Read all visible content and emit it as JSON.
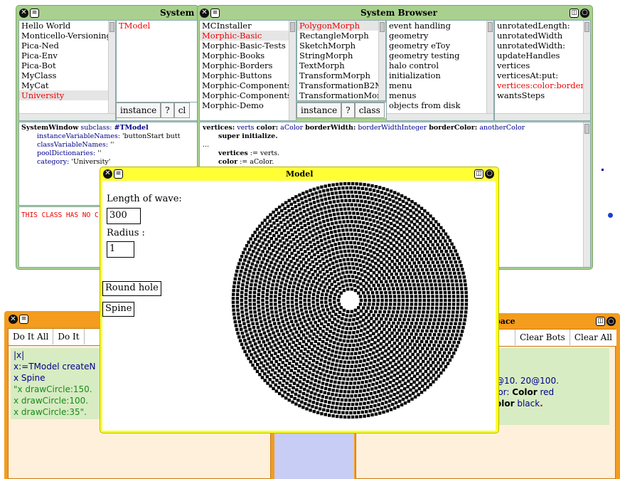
{
  "system_browser_left": {
    "title": "System",
    "packages": [
      "Hello World",
      "Monticello-Versioning",
      "Pica-Ned",
      "Pica-Env",
      "Pica-Bot",
      "MyClass",
      "MyCat",
      "University"
    ],
    "selected_package": "University",
    "classes": [
      "TModel"
    ],
    "selected_class": "TModel",
    "instance_label": "instance",
    "help_label": "?",
    "class_label": "cl",
    "definition": {
      "head": "SystemWindow",
      "subclass_msg": "subclass:",
      "class_symbol": "#TModel",
      "ivars_label": "instanceVariableNames:",
      "ivars_value": "'buttonStart butt",
      "cvars_label": "classVariableNames:",
      "cvars_value": "''",
      "pool_label": "poolDictionaries:",
      "pool_value": "''",
      "category_label": "category:",
      "category_value": "'University'"
    },
    "comment": "THIS CLASS HAS NO C"
  },
  "system_browser_right": {
    "title": "System Browser",
    "packages": [
      "MCInstaller",
      "Morphic-Basic",
      "Morphic-Basic-Tests",
      "Morphic-Books",
      "Morphic-Borders",
      "Morphic-Buttons",
      "Morphic-Components",
      "Morphic-Components",
      "Morphic-Demo"
    ],
    "selected_package": "Morphic-Basic",
    "classes": [
      "PolygonMorph",
      "RectangleMorph",
      "SketchMorph",
      "StringMorph",
      "TextMorph",
      "TransformMorph",
      "TransformationB2Mo",
      "TransformationMorph"
    ],
    "selected_class": "PolygonMorph",
    "categories": [
      "event handling",
      "geometry",
      "geometry eToy",
      "geometry testing",
      "halo control",
      "initialization",
      "menu",
      "menus",
      "objects from disk"
    ],
    "methods": [
      "unrotatedLength:",
      "unrotatedWidth",
      "unrotatedWidth:",
      "updateHandles",
      "vertices",
      "verticesAt:put:",
      "vertices:color:border",
      "wantsSteps"
    ],
    "selected_method": "vertices:color:border",
    "instance_label": "instance",
    "help_label": "?",
    "class_label": "class",
    "source": {
      "sel1": "vertices:",
      "arg1": "verts",
      "sel2": "color:",
      "arg2": "aColor",
      "sel3": "borderWidth:",
      "arg3": "borderWidthInteger",
      "sel4": "borderColor:",
      "arg4": "anotherColor",
      "line2": "super initialize.",
      "ellipsis": "...",
      "line3a": "vertices",
      "line3b": ":= verts.",
      "line4a": "color",
      "line4b": ":= aColor."
    }
  },
  "model_window": {
    "title": "Model",
    "length_label": "Length of wave:",
    "length_value": "300",
    "radius_label": "Radius :",
    "radius_value": "1",
    "round_hole_label": "Round hole",
    "spine_label": "Spine"
  },
  "workspace_left": {
    "do_it_all": "Do It All",
    "do_it": "Do It",
    "lines": [
      "|x|",
      "x:=TModel createN",
      "x Spine",
      "\"x drawCircle:150.",
      "x drawCircle:100.",
      "x drawCircle:35\"."
    ]
  },
  "workspace_right": {
    "title": "pace",
    "clear_bots": "Clear Bots",
    "clear_all": "Clear All",
    "line1": "@10. 20@100.",
    "line2a": "lor:",
    "line2b": "Color",
    "line2c": "red",
    "line3a": "olor",
    "line3b": "black",
    "line3c": "."
  },
  "colors": {
    "browser_frame": "#a9d08e",
    "model_frame": "#ffff33",
    "workspace_frame": "#f39c1e",
    "workspace_body": "#fff0dc",
    "workspace_code_bg": "#d7ecc2",
    "desktop_strip": "#c7cdf5",
    "selection_text": "#ee0000"
  },
  "icons": {
    "close": "close-icon",
    "menu": "window-menu-icon",
    "collapse": "collapse-icon",
    "expand": "expand-icon"
  },
  "spiral": {
    "rings": 26,
    "inner_radius": 16,
    "outer_radius": 164
  }
}
